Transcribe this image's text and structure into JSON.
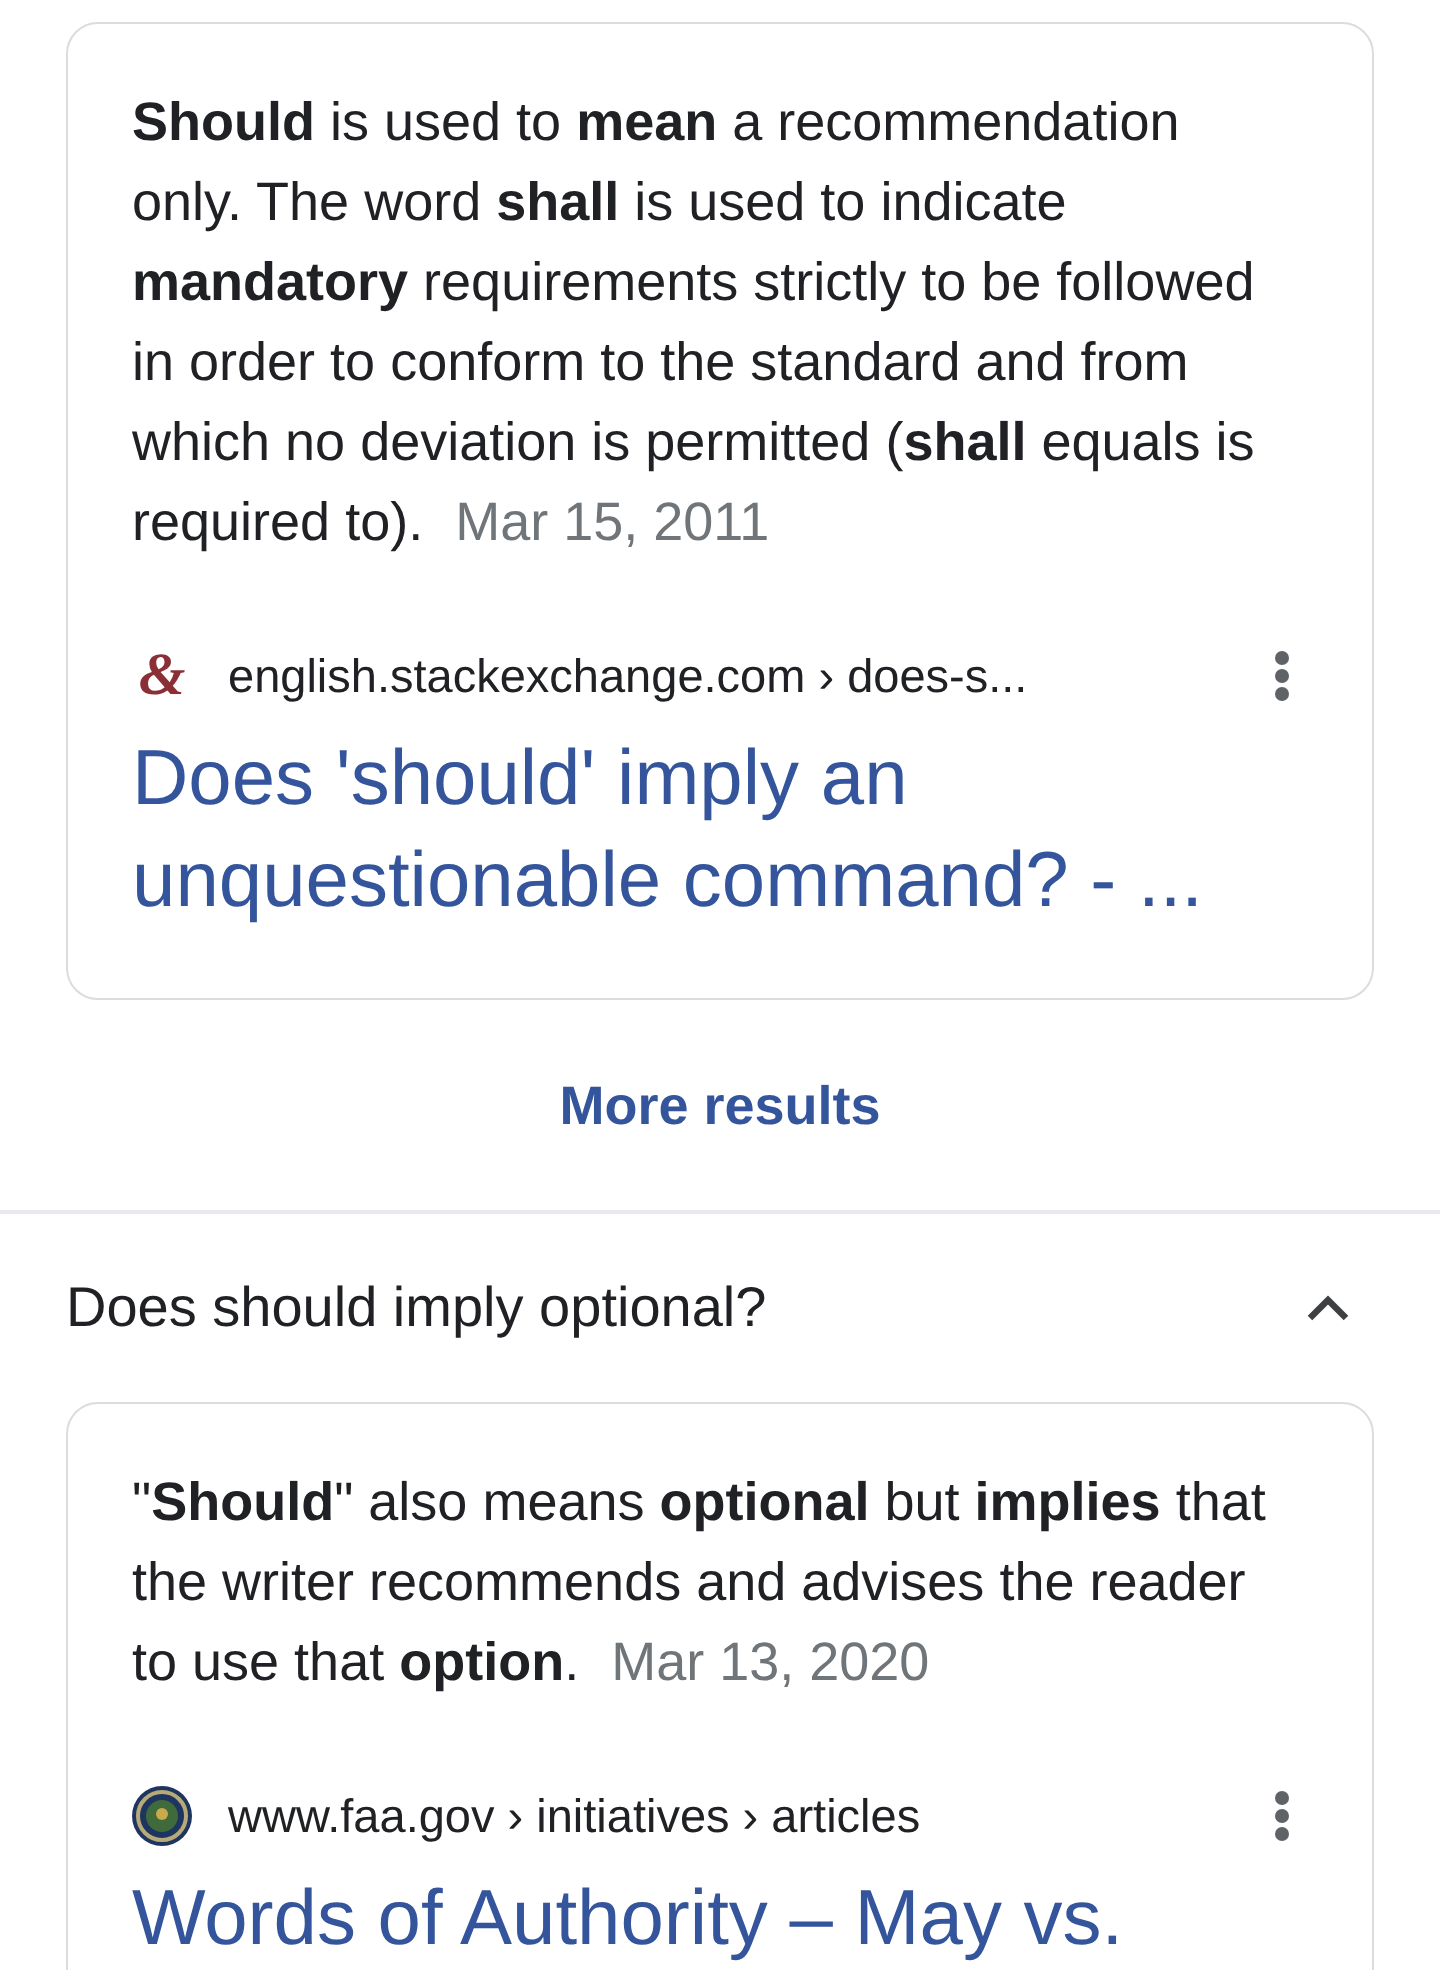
{
  "top_result": {
    "snippet": "**Should** is used to **mean** a recommendation only. The word **shall** is used to indicate **mandatory** requirements strictly to be followed in order to conform to the standard and from which no deviation is permitted (**shall** equals is required to).",
    "date": "Mar 15, 2011",
    "source": {
      "favicon": {
        "kind": "glyph",
        "text": "&"
      },
      "breadcrumb": "english.stackexchange.com › does-s..."
    },
    "title": "Does 'should' imply an unquestionable command? - ..."
  },
  "more_results": "More results",
  "questions": [
    {
      "question": "Does should imply optional?",
      "expanded": true,
      "answer": {
        "snippet": "\"**Should**\" also means **optional** but **implies** that the writer recommends and advises the reader to use that **option**.",
        "date": "Mar 13, 2020",
        "source": {
          "favicon": {
            "kind": "seal"
          },
          "breadcrumb": "www.faa.gov › initiatives › articles"
        },
        "title": "Words of Authority – May vs."
      }
    }
  ]
}
